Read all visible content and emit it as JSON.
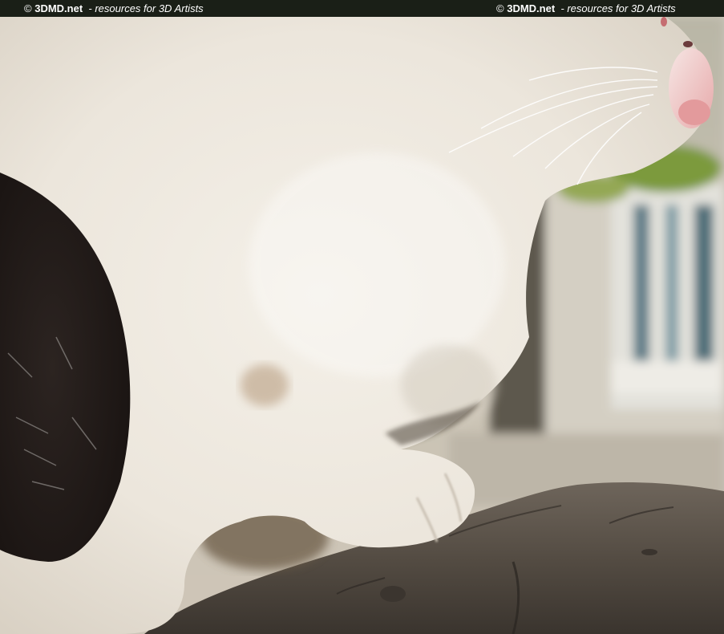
{
  "watermark": {
    "left": {
      "copyright": "©",
      "brand": "3DMD.net",
      "tagline": "- resources for 3D Artists"
    },
    "right": {
      "copyright": "©",
      "brand": "3DMD.net",
      "tagline": "- resources for 3D Artists"
    },
    "bar_color": "#1a1f17",
    "text_color": "#ffffff"
  },
  "photo": {
    "subject": "close-up-white-cat-on-branch"
  }
}
